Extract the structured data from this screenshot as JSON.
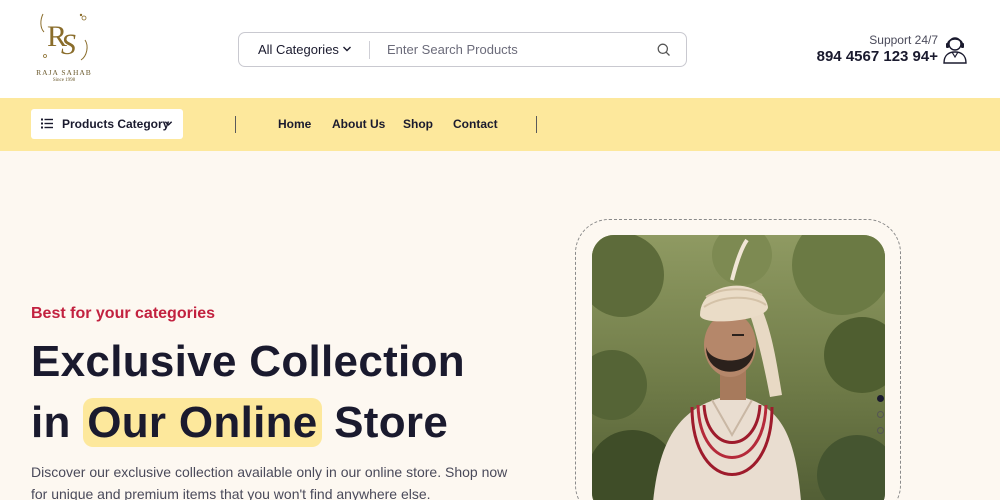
{
  "brand": {
    "logo_text": "RS",
    "name": "RAJA SAHAB",
    "since": "Since 1998",
    "color": "#8a6d2b"
  },
  "search": {
    "category_label": "All Categories",
    "placeholder": "Enter Search Products"
  },
  "support": {
    "label": "Support 24/7",
    "phone": "894 4567 123 94+"
  },
  "nav": {
    "category_button": "Products Category",
    "links": [
      "Home",
      "About Us",
      "Shop",
      "Contact"
    ]
  },
  "hero": {
    "tagline": "Best for your categories",
    "title_line1": "Exclusive Collection",
    "title_in": "in",
    "title_highlight": "Our Online",
    "title_store": "Store",
    "description": "Discover our exclusive collection available only in our online store. Shop now for unique and premium items that you won't find anywhere else."
  },
  "slider": {
    "slide_count": 3,
    "active_slide": 1
  },
  "colors": {
    "accent_yellow": "#fde89c",
    "tagline_red": "#c2213f",
    "page_background": "#fdf8f1",
    "text_dark": "#1a1a2e"
  },
  "icons": {
    "search": "search-icon",
    "chevron": "chevron-down-icon",
    "category_list": "list-icon",
    "support": "support-agent-icon"
  }
}
